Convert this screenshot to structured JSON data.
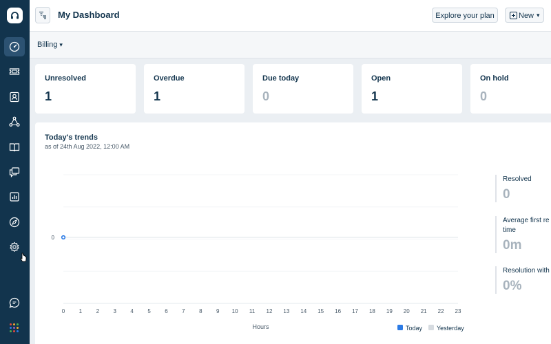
{
  "header": {
    "title": "My Dashboard",
    "explore_label": "Explore your plan",
    "new_label": "New"
  },
  "filter": {
    "group_label": "Billing"
  },
  "sidebar": {
    "items": [
      {
        "icon": "dashboard-icon",
        "active": true
      },
      {
        "icon": "ticket-icon"
      },
      {
        "icon": "contacts-icon"
      },
      {
        "icon": "social-icon"
      },
      {
        "icon": "solutions-book-icon"
      },
      {
        "icon": "forums-icon"
      },
      {
        "icon": "reports-icon"
      },
      {
        "icon": "explore-icon"
      },
      {
        "icon": "settings-icon"
      }
    ],
    "bottom": [
      {
        "icon": "chat-icon"
      },
      {
        "icon": "apps-grid-icon"
      }
    ],
    "accent": "#12344d"
  },
  "cards": [
    {
      "label": "Unresolved",
      "value": "1",
      "muted": false
    },
    {
      "label": "Overdue",
      "value": "1",
      "muted": false
    },
    {
      "label": "Due today",
      "value": "0",
      "muted": true
    },
    {
      "label": "Open",
      "value": "1",
      "muted": false
    },
    {
      "label": "On hold",
      "value": "0",
      "muted": true
    }
  ],
  "trends": {
    "title": "Today's trends",
    "subtitle": "as of 24th Aug 2022, 12:00 AM"
  },
  "metrics": [
    {
      "label1": "Resolved",
      "label2": "",
      "value": "0"
    },
    {
      "label1": "Average first re",
      "label2": "time",
      "value": "0m"
    },
    {
      "label1": "Resolution with",
      "label2": "",
      "value": "0%"
    }
  ],
  "chart_data": {
    "type": "line",
    "x": [
      "0",
      "1",
      "2",
      "3",
      "4",
      "5",
      "6",
      "7",
      "8",
      "9",
      "10",
      "11",
      "12",
      "13",
      "14",
      "15",
      "16",
      "17",
      "18",
      "19",
      "20",
      "21",
      "22",
      "23"
    ],
    "series": [
      {
        "name": "Today",
        "values": [
          0
        ],
        "color": "#2c7be5"
      },
      {
        "name": "Yesterday",
        "values": [],
        "color": "#d6dbe0"
      }
    ],
    "xlabel": "Hours",
    "ylabel": "",
    "ytick": "0",
    "grid": true,
    "legend": "bottom-right"
  }
}
